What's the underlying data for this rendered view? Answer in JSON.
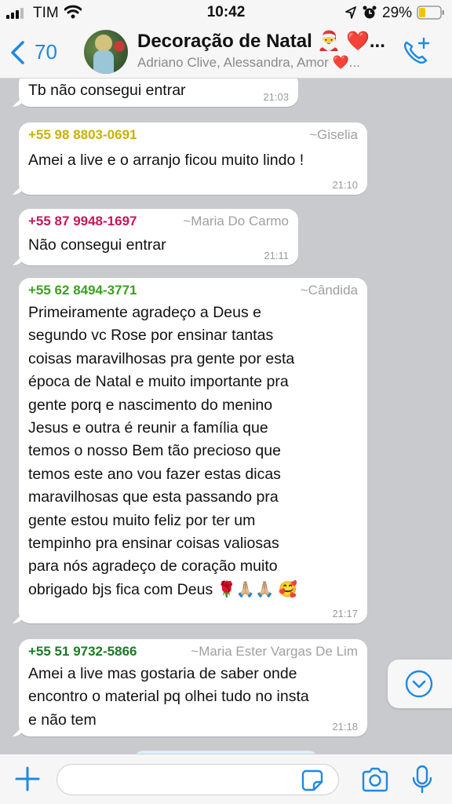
{
  "status": {
    "carrier": "TIM",
    "time": "10:42",
    "battery": "29%"
  },
  "header": {
    "back_count": "70",
    "title": "Decoração de Natal 🎅 ❤️...",
    "subtitle": "Adriano Clive, Alessandra, Amor ❤️..."
  },
  "messages": [
    {
      "text": "Tb não consegui entrar",
      "time": "21:03"
    },
    {
      "number": "+55 98 8803-0691",
      "name": "~Giselia",
      "color": "#c9b200",
      "text": "Amei a live e o arranjo ficou muito lindo !",
      "time": "21:10"
    },
    {
      "number": "+55 87 9948-1697",
      "name": "~Maria Do Carmo",
      "color": "#c2185b",
      "text": "Não consegui entrar",
      "time": "21:11"
    },
    {
      "number": "+55 62 8494-3771",
      "name": "~Cândida",
      "color": "#3aa21c",
      "lines": [
        "Primeiramente  agradeço  a Deus  e",
        "segundo vc Rose por ensinar  tantas",
        "coisas  maravilhosas  pra gente  por esta",
        "época  de Natal  e muito  importante  pra",
        "gente  porq e nascimento  do menino",
        "Jesus  e outra é reunir  a família  que",
        "temos o nosso Bem tão  precioso  que",
        "temos este ano vou fazer estas dicas",
        "maravilhosas  que esta passando  pra",
        "gente  estou muito  feliz  por  ter um",
        "tempinho  pra ensinar coisas valiosas",
        "para nós agradeço de coração  muito",
        "obrigado bjs fica com Deus  🌹🙏🏼🙏🏼 🥰"
      ],
      "time": "21:17"
    },
    {
      "number": "+55 51 9732-5866",
      "name": "~Maria Ester Vargas De Lim",
      "color": "#1b7a24",
      "lines": [
        "Amei a live mas gostaria de saber onde",
        "encontro o material pq olhei tudo no insta",
        "e não tem"
      ],
      "time": "21:18"
    }
  ],
  "icons": {
    "signal": "signal-icon",
    "wifi": "wifi-icon",
    "location": "location-arrow-icon",
    "alarm": "alarm-icon",
    "battery": "battery-icon",
    "back": "chevron-left-icon",
    "call": "add-call-icon",
    "scroll": "chevron-down-circle-icon",
    "plus": "plus-icon",
    "sticker": "sticker-icon",
    "camera": "camera-icon",
    "mic": "microphone-icon"
  },
  "colors": {
    "accent": "#1e88e5",
    "chat_background": "#c9cacd",
    "battery_fill": "#f5c400"
  }
}
